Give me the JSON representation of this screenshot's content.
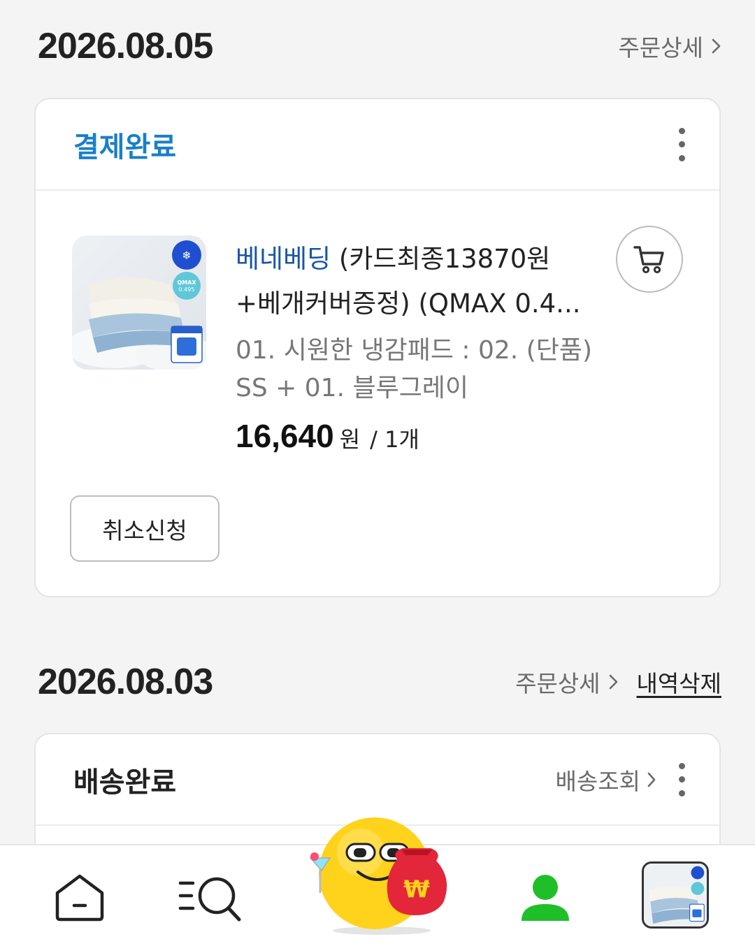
{
  "orders": [
    {
      "date": "2026.08.05",
      "detail_label": "주문상세",
      "status": "결제완료",
      "product": {
        "brand": "베네베딩",
        "title": " (카드최종13870원 +베개커버증정) (QMAX 0.4...",
        "option": "01. 시원한 냉감패드 : 02. (단품) SS + 01. 블루그레이",
        "price": "16,640",
        "currency": "원",
        "quantity": "/ 1개",
        "thumb_badge": "QMAX 0.495"
      },
      "cancel_label": "취소신청"
    },
    {
      "date": "2026.08.03",
      "detail_label": "주문상세",
      "delete_label": "내역삭제",
      "status": "배송완료",
      "track_label": "배송조회"
    }
  ],
  "bottom_nav": {
    "items": [
      "home-icon",
      "category-search-icon",
      "event-mascot",
      "my-page-icon",
      "recent-item"
    ]
  },
  "colors": {
    "status_blue": "#1a7fc8",
    "brand_blue": "#1a55a8",
    "mypage_green": "#1fbf2a"
  }
}
